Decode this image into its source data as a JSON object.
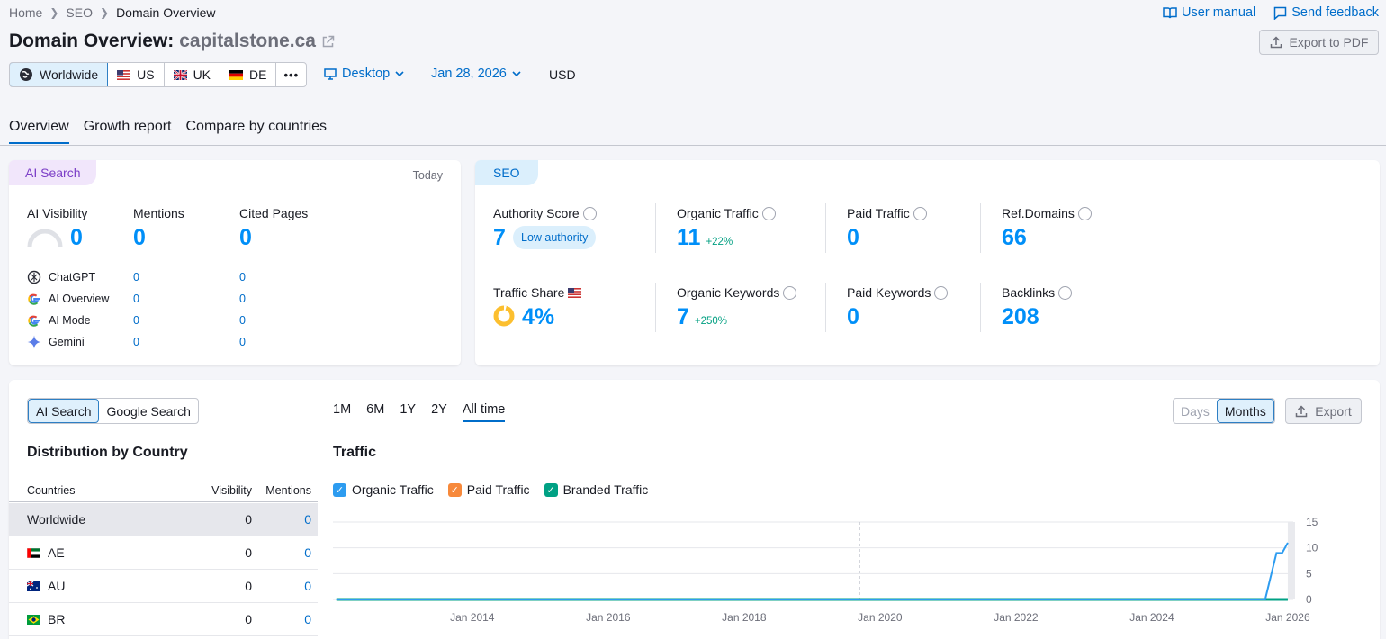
{
  "breadcrumb": [
    "Home",
    "SEO",
    "Domain Overview"
  ],
  "header_links": {
    "manual": "User manual",
    "feedback": "Send feedback"
  },
  "title": {
    "prefix": "Domain Overview:",
    "domain": "capitalstone.ca"
  },
  "export_pdf": "Export to PDF",
  "regions": [
    "Worldwide",
    "US",
    "UK",
    "DE"
  ],
  "more": "•••",
  "device": "Desktop",
  "date": "Jan 28, 2026",
  "currency": "USD",
  "tabs": [
    "Overview",
    "Growth report",
    "Compare by countries"
  ],
  "ai_card": {
    "chip": "AI Search",
    "date_label": "Today",
    "metrics": [
      {
        "label": "AI Visibility",
        "value": "0"
      },
      {
        "label": "Mentions",
        "value": "0"
      },
      {
        "label": "Cited Pages",
        "value": "0"
      }
    ],
    "engines": [
      {
        "name": "ChatGPT",
        "mentions": "0",
        "cited": "0"
      },
      {
        "name": "AI Overview",
        "mentions": "0",
        "cited": "0"
      },
      {
        "name": "AI Mode",
        "mentions": "0",
        "cited": "0"
      },
      {
        "name": "Gemini",
        "mentions": "0",
        "cited": "0"
      }
    ]
  },
  "seo_card": {
    "chip": "SEO",
    "authority": {
      "label": "Authority Score",
      "value": "7",
      "badge": "Low authority"
    },
    "organic_traffic": {
      "label": "Organic Traffic",
      "value": "11",
      "change": "+22%"
    },
    "paid_traffic": {
      "label": "Paid Traffic",
      "value": "0"
    },
    "ref_domains": {
      "label": "Ref.Domains",
      "value": "66"
    },
    "traffic_share": {
      "label": "Traffic Share",
      "value": "4%"
    },
    "organic_keywords": {
      "label": "Organic Keywords",
      "value": "7",
      "change": "+250%"
    },
    "paid_keywords": {
      "label": "Paid Keywords",
      "value": "0"
    },
    "backlinks": {
      "label": "Backlinks",
      "value": "208"
    }
  },
  "bottom": {
    "search_toggle": [
      "AI Search",
      "Google Search"
    ],
    "dist_title": "Distribution by Country",
    "columns": [
      "Countries",
      "Visibility",
      "Mentions"
    ],
    "rows": [
      {
        "country": "Worldwide",
        "visibility": "0",
        "mentions": "0"
      },
      {
        "country": "AE",
        "visibility": "0",
        "mentions": "0"
      },
      {
        "country": "AU",
        "visibility": "0",
        "mentions": "0"
      },
      {
        "country": "BR",
        "visibility": "0",
        "mentions": "0"
      }
    ],
    "ranges": [
      "1M",
      "6M",
      "1Y",
      "2Y",
      "All time"
    ],
    "granularity": [
      "Days",
      "Months"
    ],
    "export": "Export",
    "traffic_title": "Traffic",
    "legend": [
      {
        "name": "Organic Traffic",
        "color": "#2d9cf0"
      },
      {
        "name": "Paid Traffic",
        "color": "#f7893b"
      },
      {
        "name": "Branded Traffic",
        "color": "#00a184"
      }
    ]
  },
  "chart_data": {
    "type": "line",
    "title": "Traffic",
    "x_ticks": [
      "Jan 2014",
      "Jan 2016",
      "Jan 2018",
      "Jan 2020",
      "Jan 2022",
      "Jan 2024",
      "Jan 2026"
    ],
    "y_ticks": [
      "15",
      "10",
      "5",
      "0"
    ],
    "ylim": [
      0,
      15
    ],
    "series": [
      {
        "name": "Organic Traffic",
        "color": "#2d9cf0",
        "points": [
          [
            "2012-01",
            0
          ],
          [
            "2025-09",
            0
          ],
          [
            "2025-11",
            9
          ],
          [
            "2025-12",
            9
          ],
          [
            "2026-01",
            11
          ]
        ]
      },
      {
        "name": "Branded Traffic",
        "color": "#00a184",
        "points": [
          [
            "2012-01",
            0
          ],
          [
            "2026-01",
            0
          ]
        ]
      }
    ]
  }
}
